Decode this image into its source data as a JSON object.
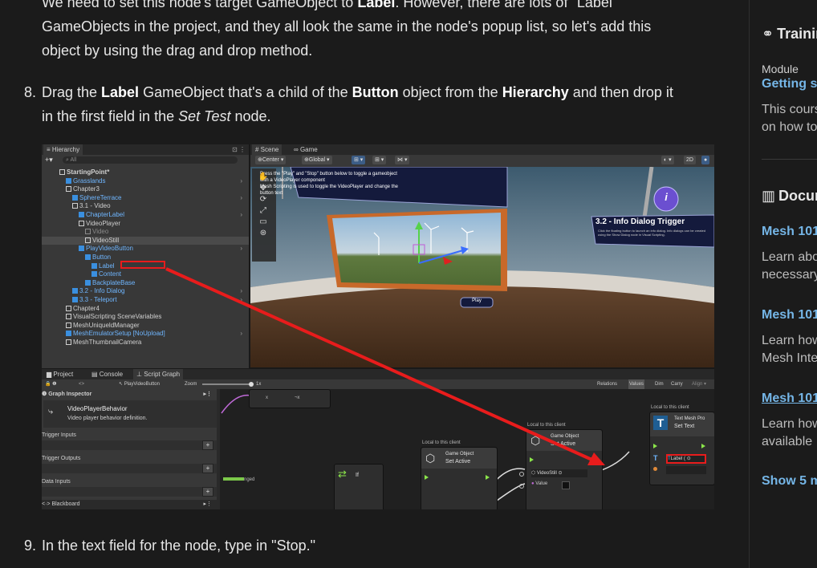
{
  "article": {
    "intro_line1_pre": "We need to set this node's target GameObject to ",
    "intro_line1_bold": "Label",
    "intro_line1_post": ". However, there are lots of \"Label\"",
    "intro_line2": "GameObjects in the project, and they all look the same in the node's popup list, so let's add this",
    "intro_line3": "object by using the drag and drop method.",
    "step8": {
      "number": "8.",
      "t1": "Drag the ",
      "b1": "Label",
      "t2": " GameObject that's a child of the ",
      "b2": "Button",
      "t3": " object from the ",
      "b3": "Hierarchy",
      "t4": " and then drop it",
      "t5": "in the first field in the ",
      "i1": "Set Test",
      "t6": " node."
    },
    "step9": {
      "number": "9.",
      "text": "In the text field for the node, type in \"Stop.\""
    }
  },
  "rail": {
    "training_heading": "Trainin",
    "module_label": "Module",
    "module_link": "Getting s",
    "course_line1": "This cours",
    "course_line2": "on how to",
    "docs_heading": "Docum",
    "links": [
      {
        "title": "Mesh 101",
        "desc1": "Learn abo",
        "desc2": "necessary"
      },
      {
        "title": "Mesh 101",
        "desc1": "Learn how",
        "desc2": "Mesh Inte"
      },
      {
        "title": "Mesh 101",
        "desc1": "Learn how",
        "desc2": "available"
      }
    ],
    "show_more": "Show 5 m"
  },
  "editor": {
    "hierarchy": {
      "tab": "Hierarchy",
      "search_placeholder": "All",
      "rows": [
        {
          "text": "StartingPoint*",
          "indent": 0,
          "style": "bold"
        },
        {
          "text": "Grasslands",
          "indent": 1,
          "style": "blue"
        },
        {
          "text": "Chapter3",
          "indent": 1,
          "style": "normal"
        },
        {
          "text": "SphereTerrace",
          "indent": 2,
          "style": "blue"
        },
        {
          "text": "3.1 - Video",
          "indent": 2,
          "style": "normal"
        },
        {
          "text": "ChapterLabel",
          "indent": 3,
          "style": "blue"
        },
        {
          "text": "VideoPlayer",
          "indent": 3,
          "style": "normal"
        },
        {
          "text": "Video",
          "indent": 4,
          "style": "gray"
        },
        {
          "text": "VideoStill",
          "indent": 4,
          "style": "sel"
        },
        {
          "text": "PlayVideoButton",
          "indent": 3,
          "style": "blue"
        },
        {
          "text": "Button",
          "indent": 4,
          "style": "blue"
        },
        {
          "text": "Label",
          "indent": 5,
          "style": "blue"
        },
        {
          "text": "Content",
          "indent": 5,
          "style": "blue"
        },
        {
          "text": "BackplateBase",
          "indent": 4,
          "style": "blue"
        },
        {
          "text": "3.2 - Info Dialog",
          "indent": 2,
          "style": "blue"
        },
        {
          "text": "3.3 - Teleport",
          "indent": 2,
          "style": "blue"
        },
        {
          "text": "Chapter4",
          "indent": 1,
          "style": "normal"
        },
        {
          "text": "VisualScripting SceneVariables",
          "indent": 1,
          "style": "normal"
        },
        {
          "text": "MeshUniqueldManager",
          "indent": 1,
          "style": "normal"
        },
        {
          "text": "MeshEmulatorSetup [NoUpload]",
          "indent": 1,
          "style": "blue"
        },
        {
          "text": "MeshThumbnailCamera",
          "indent": 1,
          "style": "normal"
        }
      ]
    },
    "scene": {
      "tab_scene": "Scene",
      "tab_game": "Game",
      "btn_center": "Center",
      "btn_global": "Global",
      "btn_2d": "2D",
      "panel_line1": "Press the \"Play\" and \"Stop\" button below to toggle a gameobject",
      "panel_line2": "with a VideoPlayer component",
      "panel_line3": "Mesh Scripting is used to toggle the VideoPlayer and change the",
      "panel_line4": "button text",
      "info_title": "3.2 - Info Dialog Trigger",
      "info_body": "Click the floating button to launch an info dialog. Info dialogs can be created using the Show Dialog node in Visual Scripting.",
      "info_icon": "i",
      "play_label": "Play"
    },
    "bottom": {
      "tab_project": "Project",
      "tab_console": "Console",
      "tab_graph": "Script Graph",
      "breadcrumb": "PlayVideoButton",
      "zoom_label": "Zoom",
      "zoom_value": "1x",
      "toolbar_right": [
        "Relations",
        "Values",
        "Dim",
        "Carry",
        "Align"
      ],
      "inspector_title": "Graph Inspector",
      "behavior_name": "VideoPlayerBehavior",
      "behavior_desc": "Video player behavior definition.",
      "trigger_inputs": "Trigger Inputs",
      "trigger_outputs": "Trigger Outputs",
      "data_inputs": "Data Inputs",
      "blackboard": "Blackboard",
      "plus": "+",
      "nodes": {
        "xnode_a": "x",
        "xnode_b": "¬x",
        "if_label": "If",
        "nged": "nged",
        "setactive1_context": "Local to this client",
        "setactive1_sub": "Game Object",
        "setactive1_title": "Set Active",
        "setactive2_context": "Local to this client",
        "setactive2_sub": "Game Object",
        "setactive2_title": "Set Active",
        "setactive2_field": "VideoStill",
        "setactive2_value": "Value",
        "settext_context": "Local to this client",
        "settext_sub": "Text Mesh Pro",
        "settext_title": "Set Text",
        "settext_field": "Label (",
        "settext_icon": "T"
      }
    }
  },
  "colors": {
    "link": "#75b6e7",
    "arrow": "#e81c1c",
    "unity_blue": "#6fb6ff",
    "flow_green": "#8be64a"
  }
}
